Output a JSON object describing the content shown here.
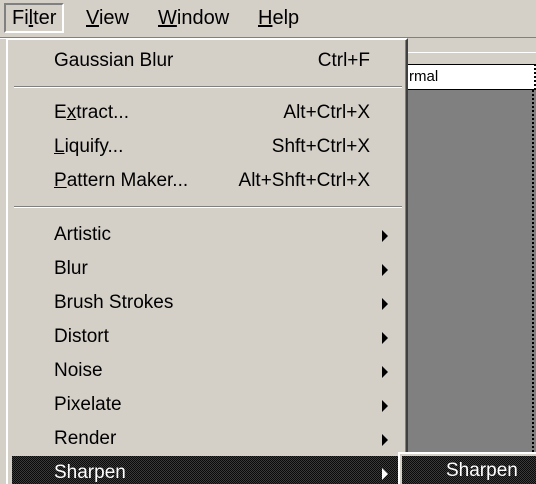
{
  "menubar": {
    "items": [
      {
        "pre": "Fi",
        "key": "l",
        "post": "ter"
      },
      {
        "pre": "",
        "key": "V",
        "post": "iew"
      },
      {
        "pre": "",
        "key": "W",
        "post": "indow"
      },
      {
        "pre": "",
        "key": "H",
        "post": "elp"
      }
    ]
  },
  "document": {
    "blend_mode": "rmal"
  },
  "filter_menu": {
    "last_filter": {
      "label": "Gaussian Blur",
      "shortcut": "Ctrl+F"
    },
    "tools": [
      {
        "pre": "E",
        "key": "x",
        "post": "tract...",
        "shortcut": "Alt+Ctrl+X"
      },
      {
        "pre": "",
        "key": "L",
        "post": "iquify...",
        "shortcut": "Shft+Ctrl+X"
      },
      {
        "pre": "",
        "key": "P",
        "post": "attern Maker...",
        "shortcut": "Alt+Shft+Ctrl+X"
      }
    ],
    "submenus": [
      {
        "label": "Artistic"
      },
      {
        "label": "Blur"
      },
      {
        "label": "Brush Strokes"
      },
      {
        "label": "Distort"
      },
      {
        "label": "Noise"
      },
      {
        "label": "Pixelate"
      },
      {
        "label": "Render"
      },
      {
        "label": "Sharpen"
      }
    ],
    "selected_index": 7
  },
  "sharpen_submenu": {
    "items": [
      {
        "label": "Sharpen"
      }
    ]
  },
  "colors": {
    "face": "#d4d0c8",
    "highlight_dither": "#0a0a0a",
    "canvas_gray": "#808080"
  },
  "icons": {
    "submenu_arrow": "chevron-right-icon"
  }
}
